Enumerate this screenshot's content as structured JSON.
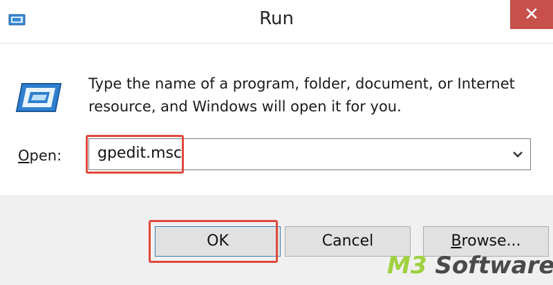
{
  "window": {
    "title": "Run",
    "close_glyph": "✕"
  },
  "content": {
    "description": "Type the name of a program, folder, document, or Internet resource, and Windows will open it for you.",
    "open_label_key": "O",
    "open_label_rest": "pen:",
    "open_value": "gpedit.msc"
  },
  "buttons": {
    "ok": "OK",
    "cancel": "Cancel",
    "browse_key": "B",
    "browse_rest": "rowse..."
  },
  "watermark": {
    "part1": "M3",
    "part2": " Software"
  },
  "colors": {
    "close": "#c7504b",
    "highlight": "#e0473b",
    "watermark_accent": "#9fd13f",
    "watermark_dark": "#4a4a4a"
  },
  "icons": [
    "run-title-icon",
    "close-icon",
    "run-app-icon",
    "chevron-down-icon"
  ]
}
